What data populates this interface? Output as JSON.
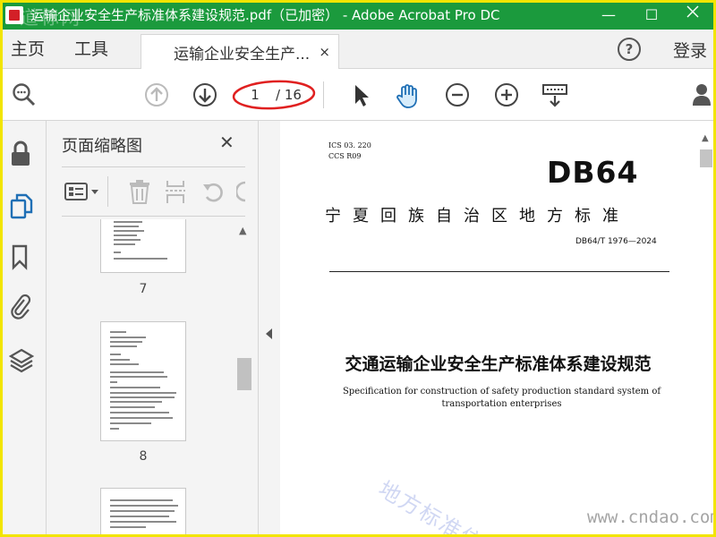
{
  "window": {
    "title": "运输企业安全生产标准体系建设规范.pdf（已加密） - Adobe Acrobat Pro DC",
    "watermark": "道标网",
    "controls": {
      "minimize": "—",
      "maximize": "☐"
    },
    "accent_color": "#1b9a3d",
    "frame_color": "#f2e500"
  },
  "menubar": {
    "home": "主页",
    "tools": "工具",
    "document_tab": "运输企业安全生产...",
    "close_tab": "×",
    "help": "?",
    "login": "登录"
  },
  "toolbar": {
    "page_current": "1",
    "page_total": "/ 16",
    "icons": [
      "search-zoom-icon",
      "page-up-icon",
      "page-down-icon",
      "select-arrow-icon",
      "hand-icon",
      "zoom-out-icon",
      "zoom-in-icon",
      "keyboard-scroll-icon",
      "share-user-icon"
    ]
  },
  "rail": {
    "icons": [
      "lock-icon",
      "pages-icon",
      "bookmark-icon",
      "attachment-icon",
      "layers-icon"
    ]
  },
  "thumbnails": {
    "title": "页面缩略图",
    "close": "✕",
    "pages": [
      {
        "number": "7"
      },
      {
        "number": "8"
      }
    ]
  },
  "document": {
    "ics_line1": "ICS   03. 220",
    "ics_line2": "CCS   R09",
    "logo": "DB64",
    "standard_title": "宁夏回族自治区地方标准",
    "standard_number": "DB64/T 1976—2024",
    "cn_title": "交通运输企业安全生产标准体系建设规范",
    "en_title": "Specification for construction of safety production standard system of transportation enterprises",
    "watermark_cn": "地方标准信",
    "watermark_url": "www.cndao.com"
  }
}
